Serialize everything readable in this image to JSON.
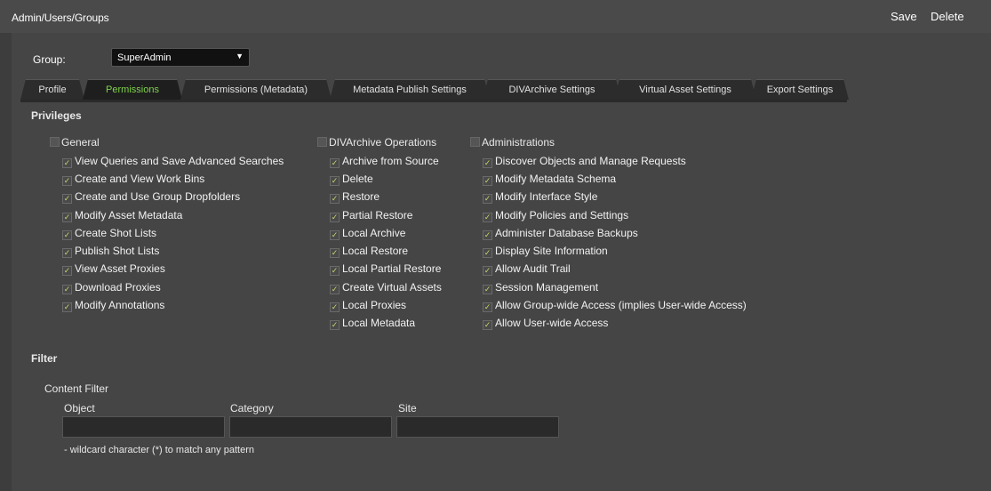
{
  "header": {
    "breadcrumb": "Admin/Users/Groups",
    "save_label": "Save",
    "delete_label": "Delete"
  },
  "group": {
    "label": "Group:",
    "selected": "SuperAdmin"
  },
  "tabs": [
    {
      "label": "Profile"
    },
    {
      "label": "Permissions"
    },
    {
      "label": "Permissions (Metadata)"
    },
    {
      "label": "Metadata Publish Settings"
    },
    {
      "label": "DIVArchive Settings"
    },
    {
      "label": "Virtual Asset Settings"
    },
    {
      "label": "Export Settings"
    }
  ],
  "privileges": {
    "title": "Privileges",
    "general": {
      "title": "General",
      "items": [
        "View Queries and Save Advanced Searches",
        "Create and View Work Bins",
        "Create and Use Group Dropfolders",
        "Modify Asset Metadata",
        "Create Shot Lists",
        "Publish Shot Lists",
        "View Asset Proxies",
        "Download Proxies",
        "Modify Annotations"
      ]
    },
    "divarchive": {
      "title": "DIVArchive Operations",
      "items": [
        "Archive from Source",
        "Delete",
        "Restore",
        "Partial Restore",
        "Local Archive",
        "Local Restore",
        "Local Partial Restore",
        "Create Virtual Assets",
        "Local Proxies",
        "Local Metadata"
      ]
    },
    "admin": {
      "title": "Administrations",
      "items": [
        "Discover Objects and Manage Requests",
        "Modify Metadata Schema",
        "Modify Interface Style",
        "Modify Policies and Settings",
        "Administer Database Backups",
        "Display Site Information",
        "Allow Audit Trail",
        "Session Management",
        "Allow Group-wide Access (implies User-wide Access)",
        "Allow User-wide Access"
      ]
    }
  },
  "filter": {
    "title": "Filter",
    "subtitle": "Content Filter",
    "object_label": "Object",
    "category_label": "Category",
    "site_label": "Site",
    "object_value": "",
    "category_value": "",
    "site_value": "",
    "hint": "- wildcard character (*) to match any pattern"
  }
}
